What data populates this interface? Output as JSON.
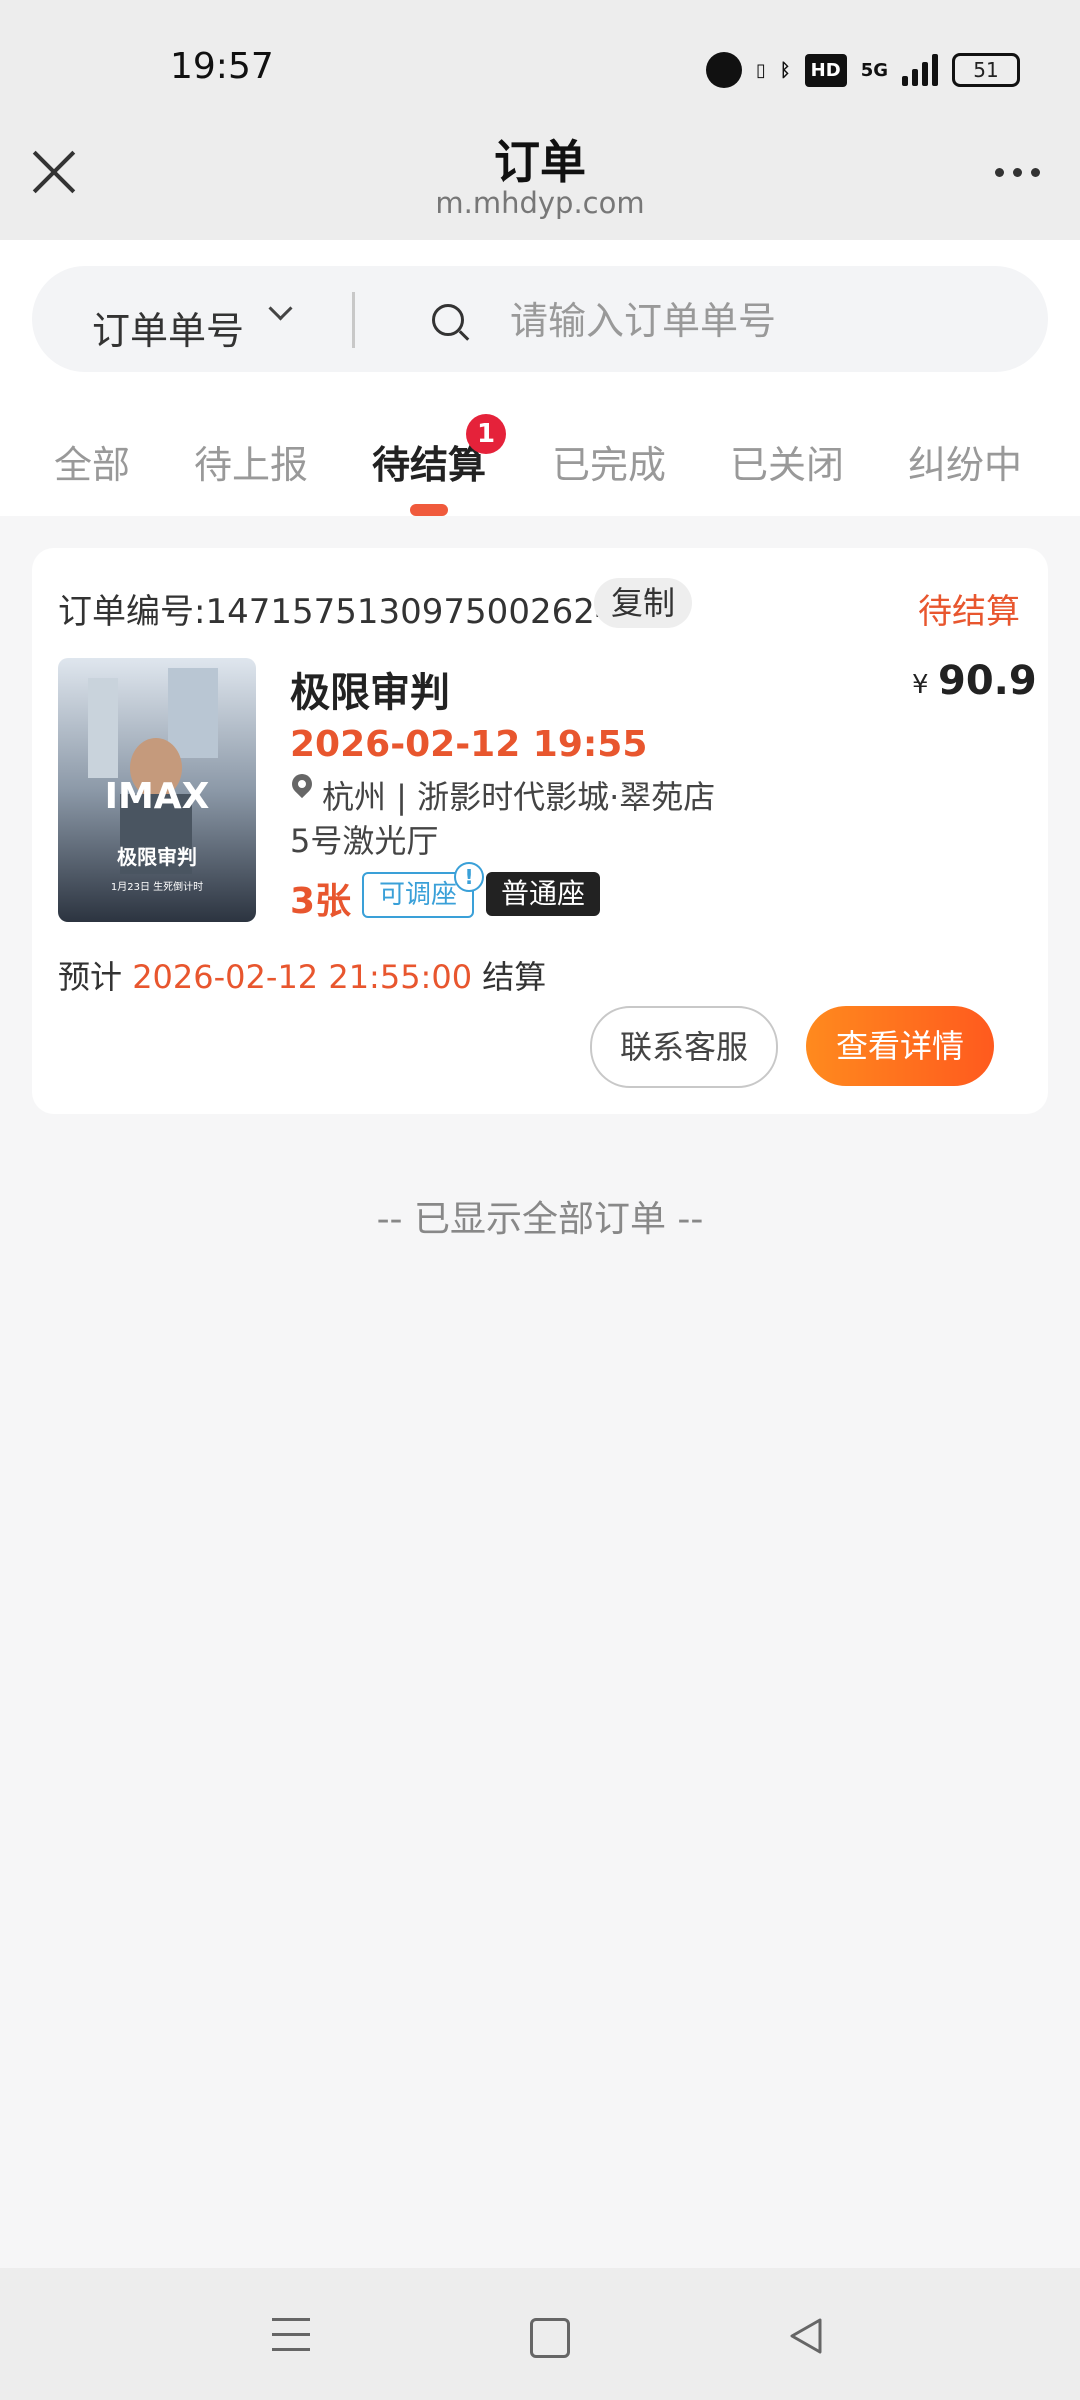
{
  "status_bar": {
    "time": "19:57",
    "network": "5G",
    "hd": "HD",
    "battery": "51"
  },
  "header": {
    "title": "订单",
    "url": "m.mhdyp.com"
  },
  "search": {
    "type_label": "订单单号",
    "placeholder": "请输入订单单号"
  },
  "tabs": [
    {
      "label": "全部"
    },
    {
      "label": "待上报"
    },
    {
      "label": "待结算",
      "active": true,
      "badge": "1"
    },
    {
      "label": "已完成"
    },
    {
      "label": "已关闭"
    },
    {
      "label": "纠纷中"
    }
  ],
  "order": {
    "number_label": "订单编号:",
    "number": "1471575130975002624",
    "copy_label": "复制",
    "status": "待结算",
    "poster": {
      "brand": "IMAX",
      "title": "极限审判",
      "date_text": "1月23日 生死倒计时"
    },
    "movie_title": "极限审判",
    "price_symbol": "¥",
    "price": "90.9",
    "showtime": "2026-02-12 19:55",
    "cinema": "杭州 | 浙影时代影城·翠苑店",
    "hall": "5号激光厅",
    "ticket_count": "3张",
    "adjustable_tag": "可调座",
    "seat_tag": "普通座",
    "settle_prefix": "预计",
    "settle_time": "2026-02-12 21:55:00",
    "settle_suffix": "结算",
    "contact_label": "联系客服",
    "detail_label": "查看详情"
  },
  "end_text": "-- 已显示全部订单 --",
  "colors": {
    "accent": "#e8562e",
    "badge": "#e5223a",
    "tag_blue": "#3aa0d8"
  },
  "bottom_nav": {
    "icons": [
      "menu-icon",
      "home-icon",
      "back-icon"
    ]
  }
}
